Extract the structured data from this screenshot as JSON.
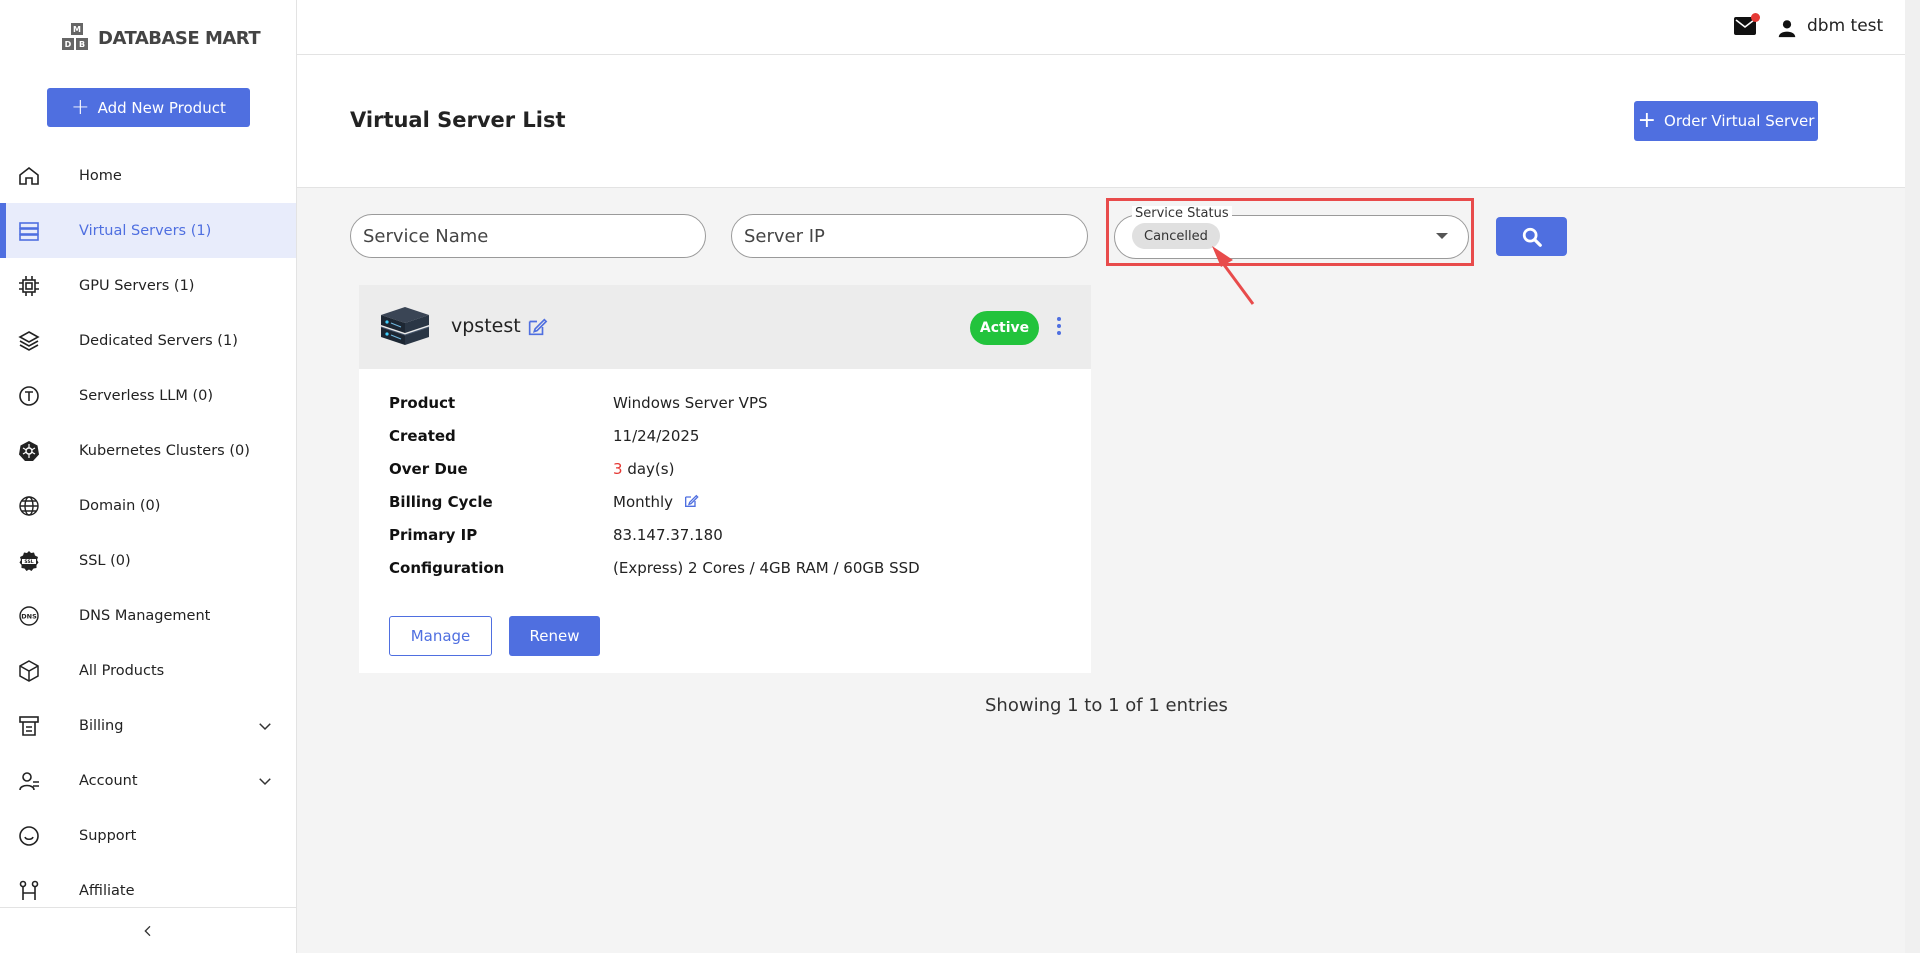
{
  "brand": {
    "logo_text": "DATABASE MART",
    "logo_letters": [
      "M",
      "D",
      "B"
    ]
  },
  "sidebar": {
    "add_button": "Add New Product",
    "items": [
      {
        "label": "Home",
        "icon": "home-icon"
      },
      {
        "label": "Virtual Servers (1)",
        "icon": "server-stack-icon",
        "active": true
      },
      {
        "label": "GPU Servers (1)",
        "icon": "gpu-chip-icon"
      },
      {
        "label": "Dedicated Servers (1)",
        "icon": "dedicated-server-icon"
      },
      {
        "label": "Serverless LLM (0)",
        "icon": "llm-icon"
      },
      {
        "label": "Kubernetes Clusters (0)",
        "icon": "kubernetes-icon"
      },
      {
        "label": "Domain (0)",
        "icon": "globe-icon"
      },
      {
        "label": "SSL (0)",
        "icon": "ssl-icon"
      },
      {
        "label": "DNS Management",
        "icon": "dns-icon"
      },
      {
        "label": "All Products",
        "icon": "box-icon"
      },
      {
        "label": "Billing",
        "icon": "billing-icon",
        "expandable": true
      },
      {
        "label": "Account",
        "icon": "account-icon",
        "expandable": true
      },
      {
        "label": "Support",
        "icon": "support-icon"
      },
      {
        "label": "Affiliate",
        "icon": "affiliate-icon"
      }
    ]
  },
  "header": {
    "user_name": "dbm test"
  },
  "page": {
    "title": "Virtual Server List",
    "order_button": "Order Virtual Server"
  },
  "filters": {
    "service_name_placeholder": "Service Name",
    "server_ip_placeholder": "Server IP",
    "status_label": "Service Status",
    "status_value": "Cancelled"
  },
  "server": {
    "name": "vpstest",
    "status": "Active",
    "fields": {
      "product_label": "Product",
      "product": "Windows Server VPS",
      "created_label": "Created",
      "created": "11/24/2025",
      "overdue_label": "Over Due",
      "overdue_days": "3",
      "overdue_unit": "day(s)",
      "billing_label": "Billing Cycle",
      "billing": "Monthly",
      "ip_label": "Primary IP",
      "ip": "83.147.37.180",
      "config_label": "Configuration",
      "config": "(Express) 2 Cores / 4GB RAM / 60GB SSD"
    },
    "manage_button": "Manage",
    "renew_button": "Renew"
  },
  "pagination": {
    "summary": "Showing 1 to 1 of 1 entries"
  },
  "colors": {
    "accent": "#4f6fe0",
    "active_badge": "#22c33c",
    "highlight": "#e84b4b",
    "overdue": "#e53935"
  }
}
